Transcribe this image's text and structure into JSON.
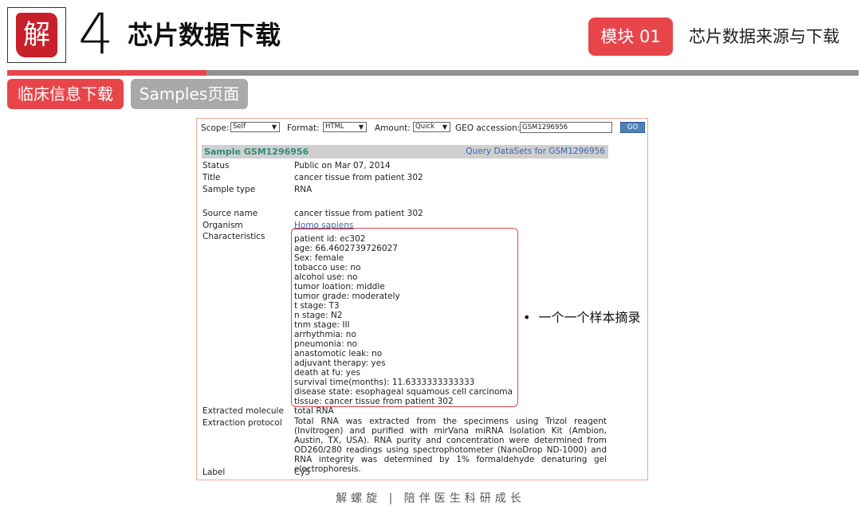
{
  "header": {
    "logo_char": "解",
    "chapter_number": "4",
    "chapter_title": "芯片数据下载",
    "module_badge": "模块 01",
    "module_title": "芯片数据来源与下载",
    "accent_color": "#e8454b"
  },
  "tags": {
    "clinical": "临床信息下载",
    "samples_page": "Samples页面"
  },
  "geo": {
    "toolbar": {
      "scope_label": "Scope:",
      "scope_value": "Self",
      "format_label": "Format:",
      "format_value": "HTML",
      "amount_label": "Amount:",
      "amount_value": "Quick",
      "accession_label": "GEO accession:",
      "accession_value": "GSM1296956",
      "go_label": "GO"
    },
    "sample_title": "Sample GSM1296956",
    "query_link": "Query DataSets for GSM1296956",
    "fields": {
      "status": {
        "label": "Status",
        "value": "Public on Mar 07, 2014"
      },
      "title": {
        "label": "Title",
        "value": "cancer tissue from patient 302"
      },
      "sample_type": {
        "label": "Sample type",
        "value": "RNA"
      },
      "source_name": {
        "label": "Source name",
        "value": "cancer tissue from patient 302"
      },
      "organism": {
        "label": "Organism",
        "value": "Homo sapiens"
      },
      "characteristics_label": "Characteristics",
      "extracted_molecule": {
        "label": "Extracted molecule",
        "value": "total RNA"
      },
      "extraction_protocol": {
        "label": "Extraction protocol",
        "value": "Total RNA was extracted from the specimens using Trizol reagent (Invitrogen) and purified with mirVana miRNA Isolation Kit (Ambion, Austin, TX, USA). RNA purity and concentration were determined from OD260/280 readings using spectrophotometer (NanoDrop ND-1000) and RNA integrity was determined by 1% formaldehyde denaturing gel electrophoresis."
      },
      "label": {
        "label": "Label",
        "value": "Cy5"
      }
    },
    "characteristics": [
      "patient id: ec302",
      "age: 66.4602739726027",
      "Sex: female",
      "tobacco use: no",
      "alcohol use: no",
      "tumor loation: middle",
      "tumor grade: moderately",
      "t stage: T3",
      "n stage: N2",
      "tnm stage: III",
      "arrhythmia: no",
      "pneumonia: no",
      "anastomotic leak: no",
      "adjuvant therapy: yes",
      "death at fu: yes",
      "survival time(months): 11.6333333333333",
      "disease state: esophageal squamous cell carcinoma",
      "tissue: cancer tissue from patient 302"
    ]
  },
  "note": {
    "bullet": "•",
    "text": "一个一个样本摘录"
  },
  "footer": "解螺旋 | 陪伴医生科研成长"
}
